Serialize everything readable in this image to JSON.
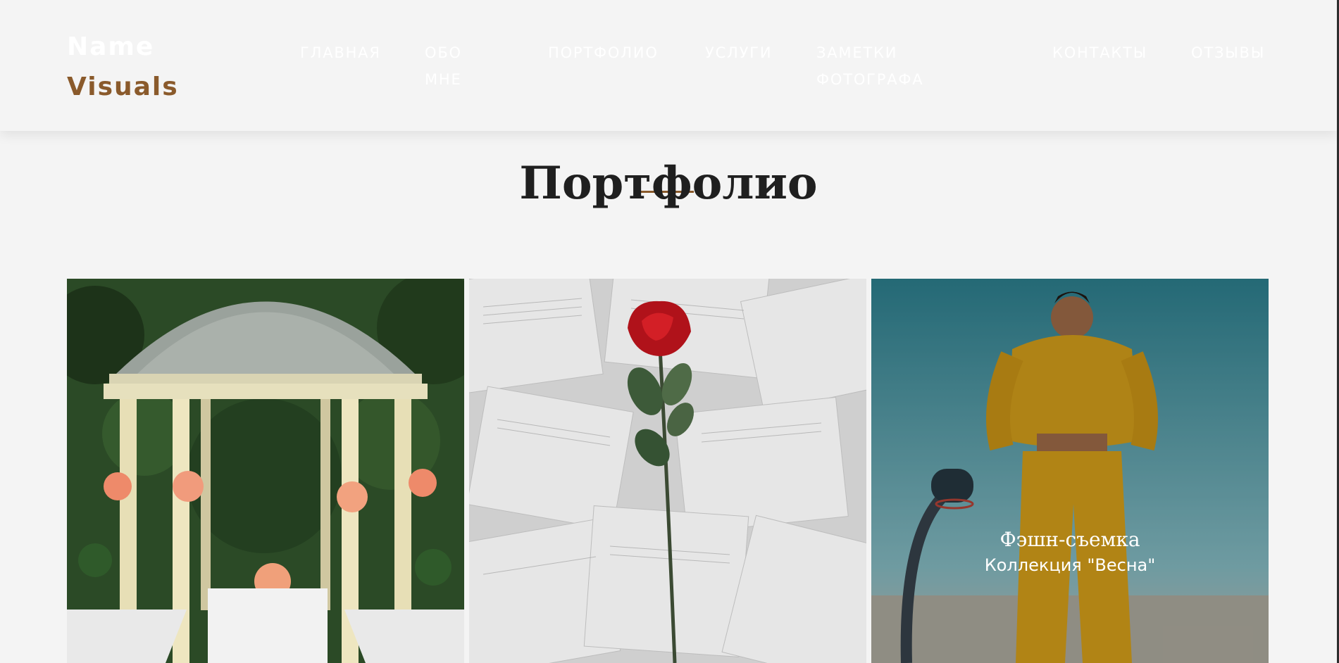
{
  "header": {
    "logo_line1": "Name",
    "logo_line2": "Visuals",
    "nav": [
      {
        "line1": "ГЛАВНАЯ",
        "line2": ""
      },
      {
        "line1": "ОБО",
        "line2": "МНЕ"
      },
      {
        "line1": "ПОРТФОЛИО",
        "line2": ""
      },
      {
        "line1": "УСЛУГИ",
        "line2": ""
      },
      {
        "line1": "ЗАМЕТКИ",
        "line2": "ФОТОГРАФА"
      },
      {
        "line1": "КОНТАКТЫ",
        "line2": ""
      },
      {
        "line1": "ОТЗЫВЫ",
        "line2": ""
      }
    ]
  },
  "section": {
    "title": "Портфолио"
  },
  "gallery": {
    "items": [
      {
        "image": "wedding-gazebo-photo",
        "title": "",
        "subtitle": ""
      },
      {
        "image": "rose-on-book-pages-photo",
        "title": "",
        "subtitle": ""
      },
      {
        "image": "fashion-yellow-outfit-photo",
        "title": "Фэшн-съемка",
        "subtitle": "Коллекция \"Весна\""
      }
    ]
  },
  "colors": {
    "accent": "#8a5a2b",
    "background": "#f4f4f4",
    "title_text": "#1f1f1f"
  }
}
